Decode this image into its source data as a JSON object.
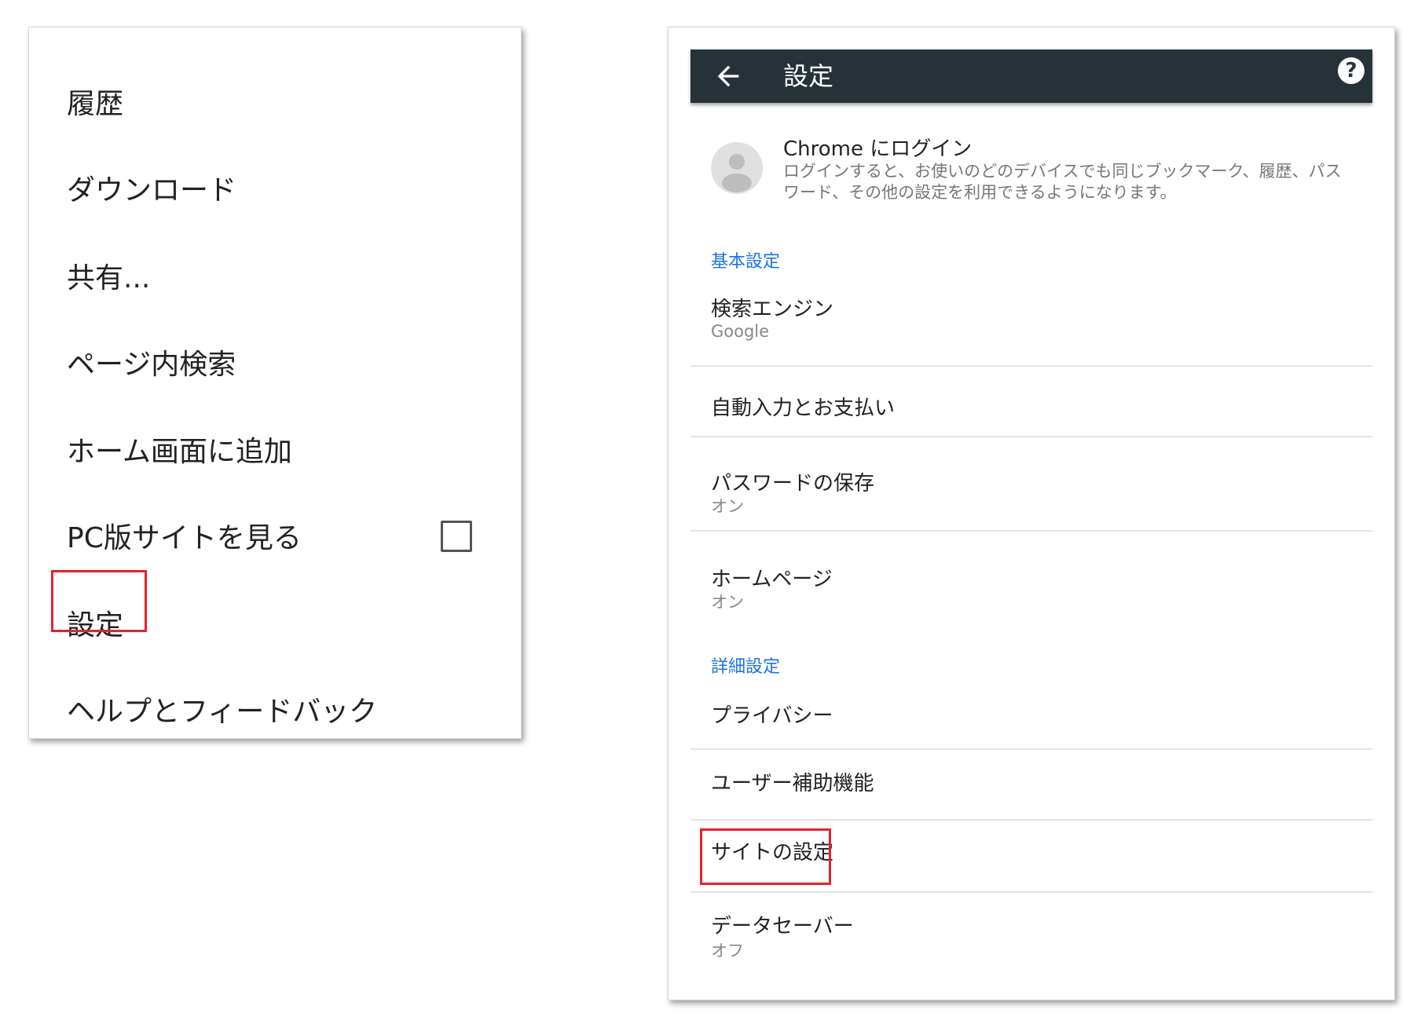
{
  "menu": {
    "items": [
      {
        "label": "履歴"
      },
      {
        "label": "ダウンロード"
      },
      {
        "label": "共有..."
      },
      {
        "label": "ページ内検索"
      },
      {
        "label": "ホーム画面に追加"
      },
      {
        "label": "PC版サイトを見る",
        "checked": false
      },
      {
        "label": "設定",
        "highlighted": true
      },
      {
        "label": "ヘルプとフィードバック"
      }
    ]
  },
  "settings": {
    "app_bar": {
      "title": "設定",
      "back_icon": "arrow-back-icon",
      "help_icon": "help-icon",
      "help_glyph": "?",
      "background_color": "#263238"
    },
    "login": {
      "title": "Chrome にログイン",
      "description": "ログインすると、お使いのどのデバイスでも同じブックマーク、履歴、パスワード、その他の設定を利用できるようになります。"
    },
    "sections": {
      "basic": "基本設定",
      "advanced": "詳細設定"
    },
    "rows": {
      "search_engine": {
        "title": "検索エンジン",
        "subtitle": "Google"
      },
      "autofill": {
        "title": "自動入力とお支払い"
      },
      "passwords": {
        "title": "パスワードの保存",
        "subtitle": "オン"
      },
      "homepage": {
        "title": "ホームページ",
        "subtitle": "オン"
      },
      "privacy": {
        "title": "プライバシー"
      },
      "accessibility": {
        "title": "ユーザー補助機能"
      },
      "site_settings": {
        "title": "サイトの設定",
        "highlighted": true
      },
      "data_saver": {
        "title": "データセーバー",
        "subtitle": "オフ"
      }
    }
  },
  "colors": {
    "accent_blue": "#1a73e8",
    "highlight_red": "#e8212b"
  }
}
